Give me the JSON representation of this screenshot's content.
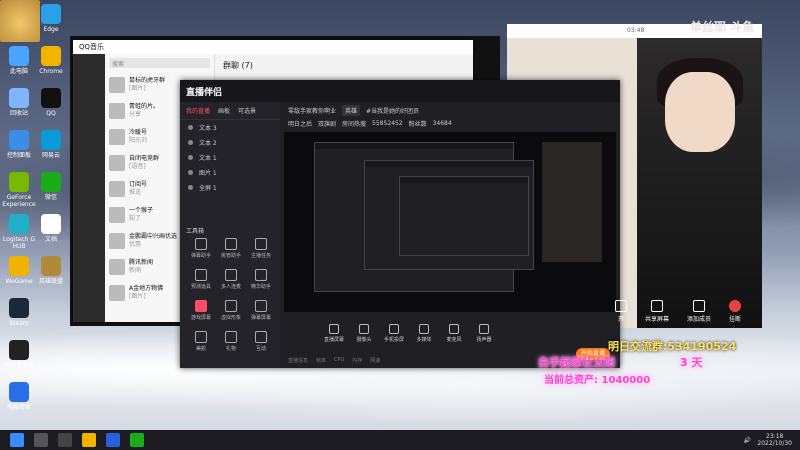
{
  "desktop": {
    "icons_left": [
      {
        "label": "此电脑",
        "color": "#4aa3ff"
      },
      {
        "label": "回收站",
        "color": "#7fb4ff"
      },
      {
        "label": "控制面板",
        "color": "#3c8de8"
      },
      {
        "label": "GeForce Experience",
        "color": "#76b900"
      },
      {
        "label": "Logitech G HUB",
        "color": "#1fb0c8"
      },
      {
        "label": "WeGame",
        "color": "#f0b400"
      },
      {
        "label": "Steam",
        "color": "#1b2838"
      },
      {
        "label": "剪映专业版",
        "color": "#222"
      },
      {
        "label": "电脑管家",
        "color": "#2a6de8"
      }
    ],
    "icons_col2": [
      {
        "label": "Edge",
        "color": "#2aa0e8"
      },
      {
        "label": "Chrome",
        "color": "#f2b400"
      },
      {
        "label": "QQ",
        "color": "#111"
      },
      {
        "label": "网易云",
        "color": "#0a9bd6"
      },
      {
        "label": "微信",
        "color": "#1aad19"
      },
      {
        "label": "文档",
        "color": "#ffffff"
      },
      {
        "label": "英雄联盟",
        "color": "#b08a3a"
      }
    ]
  },
  "qq_window": {
    "title": "QQ音乐",
    "search_placeholder": "搜索",
    "chat_title": "群聊 (7)",
    "chats": [
      {
        "name": "鼠标的虎牙群",
        "preview": "[图片]"
      },
      {
        "name": "青蛙的片。",
        "preview": "分享"
      },
      {
        "name": "冷暖号",
        "preview": "阳光刘"
      },
      {
        "name": "自闭电竞群",
        "preview": "[语音]"
      },
      {
        "name": "订阅号",
        "preview": "推送"
      },
      {
        "name": "一个猴子",
        "preview": "知了"
      },
      {
        "name": "金鹏霸中兴画优选",
        "preview": "优惠"
      },
      {
        "name": "腾讯新闻",
        "preview": "新闻"
      },
      {
        "name": "A金地方物佛",
        "preview": "[图片]"
      }
    ]
  },
  "zb_window": {
    "logo": "直播伴侣",
    "tabs": [
      "我的直播",
      "画板",
      "可选景"
    ],
    "sources": [
      "文本 3",
      "文本 2",
      "文本 1",
      "图片 1",
      "全屏 1"
    ],
    "tools_title": "工具箱",
    "tools": [
      "弹幕助手",
      "房管助手",
      "主播任务",
      "预测道具",
      "多人连麦",
      "精华助手",
      "游戏屏幕",
      "虚拟形象",
      "弹幕屏幕",
      "美颜",
      "礼物",
      "互动"
    ],
    "room_title": "零敌手家教你啊业",
    "room_tag": "英雄",
    "room_badge": "#当我是她的好团员",
    "stats": [
      "明日之后",
      "双旗剧",
      "房间热搜",
      "55852452",
      "粉丝数",
      "34684"
    ],
    "controls": [
      "直播屏幕",
      "摄像头",
      "手机投屏",
      "多媒体",
      "麦克风",
      "扬声器"
    ],
    "live_button": "开始直播",
    "status": [
      "直播信息",
      "帧率",
      "CPU",
      "内存",
      "网速"
    ]
  },
  "camera": {
    "time": "03:48"
  },
  "watermark": "单丝耶 斗鱼",
  "actions": [
    {
      "label": "开"
    },
    {
      "label": "共享屏幕"
    },
    {
      "label": "添加成员"
    },
    {
      "label": "挂断"
    }
  ],
  "overlay": {
    "line1": "明日交流群:534190524",
    "line2": "白手起家壮太阳",
    "line3": "3 天",
    "line4": "当前总资产: 1040000"
  },
  "taskbar": {
    "time": "23:18",
    "date": "2022/10/30"
  },
  "colors": {
    "accent_red": "#ff4b6b",
    "live_orange": "#ff7a1a",
    "hangup_red": "#e84343"
  }
}
